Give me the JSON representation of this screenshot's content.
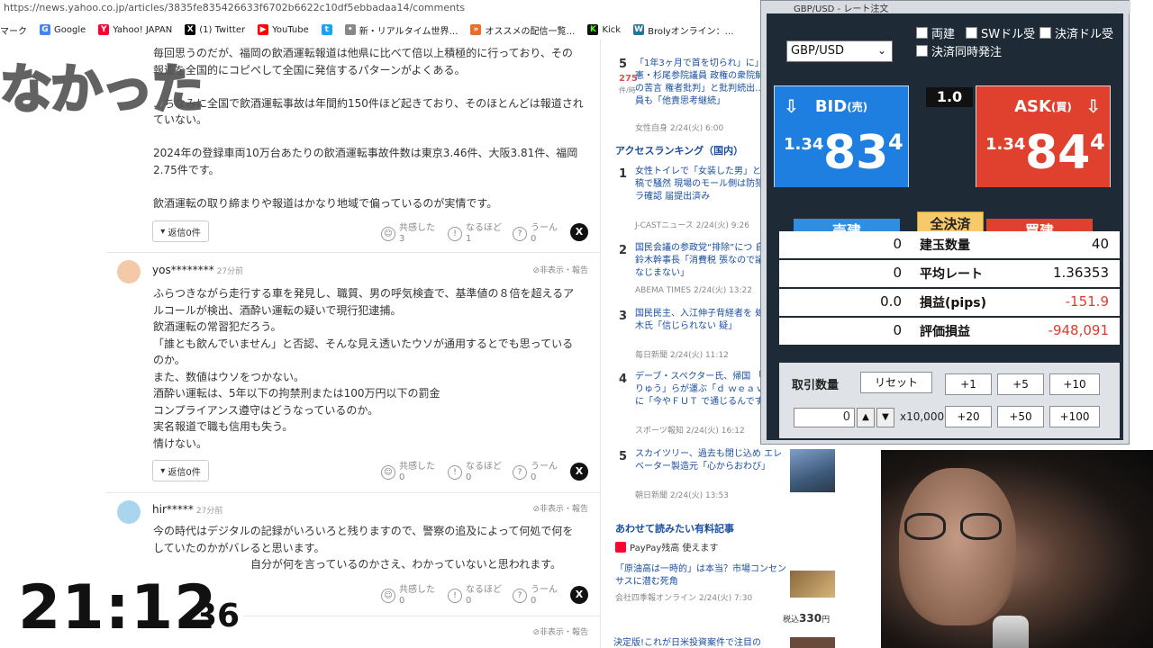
{
  "browser": {
    "url": "https://news.yahoo.co.jp/articles/3835fe835426633f6702b6622c10df5ebbadaa14/comments",
    "bookmarks": [
      "マーク",
      "Google",
      "Yahoo! JAPAN",
      "(1) Twitter",
      "YouTube",
      "新・リアルタイム世界…",
      "オススメの配信一覧…",
      "Kick",
      "Brolyオンライン：…"
    ]
  },
  "comments": [
    {
      "lines": [
        "毎回思うのだが、福岡の飲酒運転報道は他県に比べて倍以上積極的に行っており、その",
        "報道を全国的にコピペして全国に発信するパターンがよくある。",
        "",
        "…ちなみに全国で飲酒運転事故は年間約150件ほど起きており、そのほとんどは報道され",
        "ていない。",
        "",
        "2024年の登録車両10万台あたりの飲酒運転事故件数は東京3.46件、大阪3.81件、福岡",
        "2.75件です。",
        "",
        "飲酒運転の取り締まりや報道はかなり地域で偏っているのが実情です。"
      ],
      "reply": "返信0件",
      "empathy": {
        "label": "共感した",
        "count": "3"
      },
      "agree": {
        "label": "なるほど",
        "count": "1"
      },
      "hmm": {
        "label": "うーん",
        "count": "0"
      }
    },
    {
      "user": "yos********",
      "ago": "27分前",
      "hide": "非表示・報告",
      "lines": [
        "ふらつきながら走行する車を発見し、職質、男の呼気検査で、基準値の８倍を超えるア",
        "ルコールが検出、酒酔い運転の疑いで現行犯逮捕。",
        "飲酒運転の常習犯だろう。",
        "「誰とも飲んでいません」と否認、そんな見え透いたウソが通用するとでも思っている",
        "のか。",
        "また、数値はウソをつかない。",
        "酒酔い運転は、5年以下の拘禁刑または100万円以下の罰金",
        "コンプライアンス遵守はどうなっているのか。",
        "実名報道で職も信用も失う。",
        "情けない。"
      ],
      "reply": "返信0件",
      "empathy": {
        "label": "共感した",
        "count": "0"
      },
      "agree": {
        "label": "なるほど",
        "count": "0"
      },
      "hmm": {
        "label": "うーん",
        "count": "0"
      }
    },
    {
      "user": "hir*****",
      "ago": "27分前",
      "hide": "非表示・報告",
      "lines": [
        "今の時代はデジタルの記録がいろいろと残りますので、警察の追及によって何処で何を",
        "していたのかがバレると思います。",
        "自分が何を言っているのかさえ、わかっていないと思われます。"
      ],
      "empathy": {
        "label": "共感した",
        "count": "0"
      },
      "agree": {
        "label": "なるほど",
        "count": "0"
      },
      "hmm": {
        "label": "うーん",
        "count": "0"
      }
    }
  ],
  "last_hide": "非表示・報告",
  "sidebar": {
    "top_item": {
      "num": "5",
      "views": "275",
      "unit": "件/時",
      "title": "「1年3ヶ月で首を切られ」に」立憲・杉尾参院議員 政権の衆院解散への苦言 権者批判」と批判続出…旧 議員も「他責思考継続」",
      "meta": "女性自身 2/24(火) 6:00"
    },
    "ranking_title": "アクセスランキング（国内）",
    "ranking": [
      {
        "num": "1",
        "title": "女性トイレで「女装した男」と動画投稿で騒然 現場のモール側は防犯カメラ確認 届提出済み",
        "meta": "J-CASTニュース 2/24(火) 9:26"
      },
      {
        "num": "2",
        "title": "国民会議の参政党“排除”につ 自民・鈴木幹事長「消費税 張なので議論がなじまない」",
        "meta": "ABEMA TIMES 2/24(火) 13:22"
      },
      {
        "num": "3",
        "title": "国民民主、入江伸子背経者を 処分 玉木氏「信じられない 疑」",
        "meta": "毎日新聞 2/24(火) 11:12"
      },
      {
        "num": "4",
        "title": "デーブ・スペクター氏、帰国 「りくりゅう」らが運ぶ「ｄ ｗｅａｖｅ」に「今やＦＵＴ で通じるんですよ」",
        "meta": "スポーツ報知 2/24(火) 16:12"
      },
      {
        "num": "5",
        "title": "スカイツリー、過去も閉じ込め エレベーター製造元「心からおわび」",
        "meta": "朝日新聞 2/24(火) 13:53"
      }
    ],
    "paid_title": "あわせて読みたい有料記事",
    "paypay": "PayPay残高 使えます",
    "paid_item": {
      "title": "「原油高は一時的」は本当？市場コンセンサスに潜む死角",
      "meta": "会社四季報オンライン 2/24(火) 7:30",
      "price_prefix": "税込",
      "price": "330",
      "price_unit": "円"
    },
    "next_item": "決定版!これが日米投資案件で注目の"
  },
  "fx": {
    "window_title": "GBP/USD - レート注文",
    "pair": "GBP/USD",
    "checkboxes": [
      "両建",
      "SWドル受",
      "決済ドル受",
      "決済同時発注"
    ],
    "spread": "1.0",
    "bid": {
      "label": "BID",
      "suffix": "(売)",
      "small": "1.34",
      "big": "83",
      "pip": "4"
    },
    "ask": {
      "label": "ASK",
      "suffix": "(買)",
      "small": "1.34",
      "big": "84",
      "pip": "4"
    },
    "tabs": {
      "sell": "売建",
      "all_close": "全決済",
      "buy": "買建"
    },
    "rows": [
      {
        "left": "0",
        "label": "建玉数量",
        "right": "40"
      },
      {
        "left": "0",
        "label": "平均レート",
        "right": "1.36353"
      },
      {
        "left": "0.0",
        "label": "損益(pips)",
        "right": "-151.9"
      },
      {
        "left": "0",
        "label": "評価損益",
        "right": "-948,091"
      }
    ],
    "qty_label": "取引数量",
    "reset": "リセット",
    "qty_value": "0",
    "multiplier": "x10,000",
    "step_buttons": [
      "+1",
      "+5",
      "+10",
      "+20",
      "+50",
      "+100"
    ],
    "colors": {
      "bid": "#1f7fe0",
      "ask": "#e0412f",
      "negative": "#e03b2e"
    }
  },
  "overlay": {
    "caption": "なかった",
    "clock_hm": "21:12",
    "clock_sec": "36"
  }
}
